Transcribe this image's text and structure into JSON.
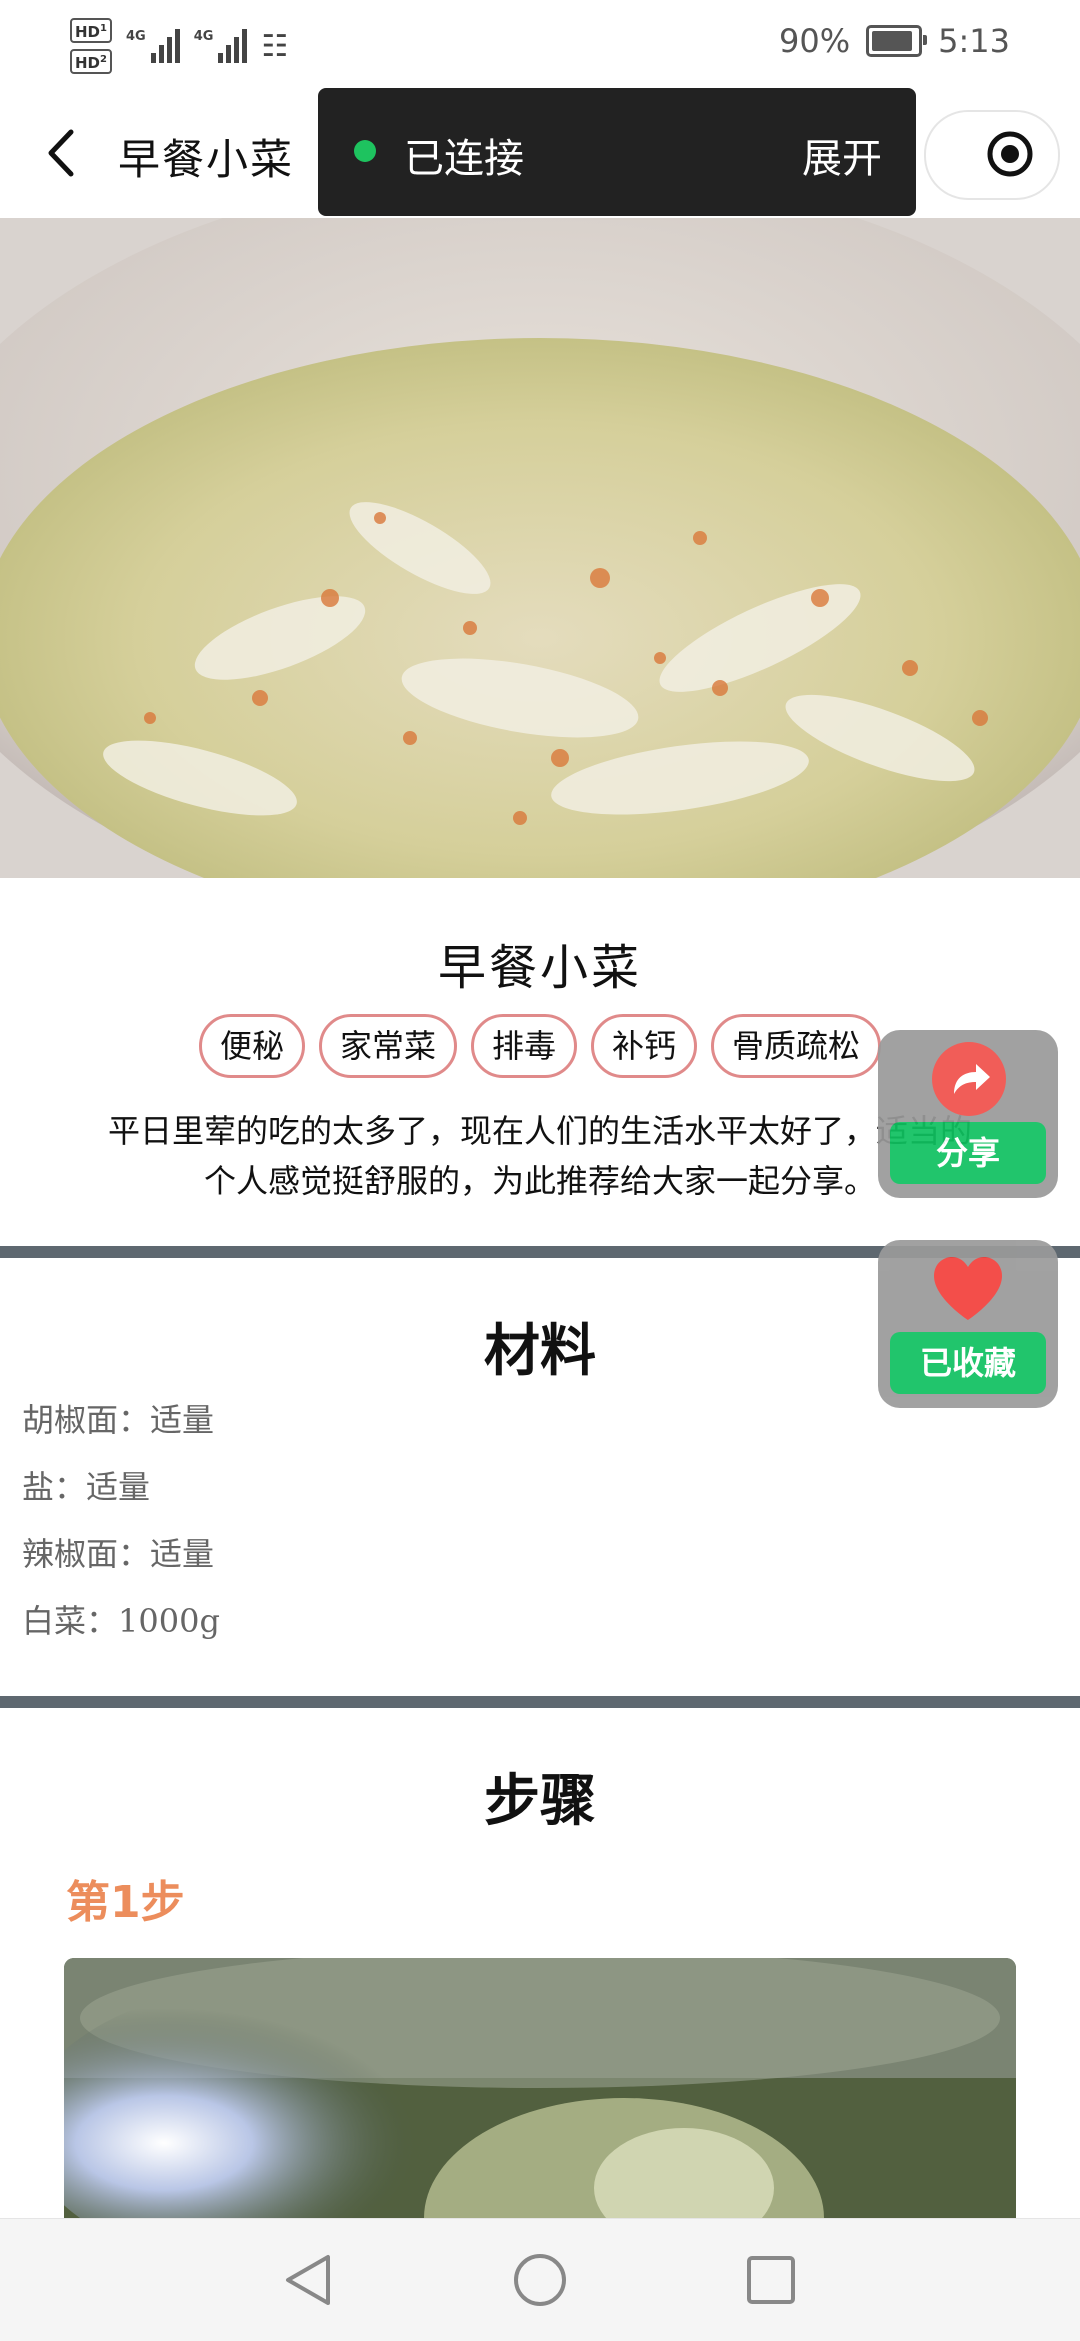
{
  "status_bar": {
    "sim1_badge": "HD",
    "sim1_index": "1",
    "sim2_badge": "HD",
    "sim2_index": "2",
    "network1": "4G",
    "network2": "4G",
    "battery_percent": "90%",
    "battery_level": 0.9,
    "time": "5:13"
  },
  "nav": {
    "title": "早餐小菜",
    "back_icon": "chevron-left-icon",
    "connection_status": "已连接",
    "expand_label": "展开",
    "capsule_icon": "target-icon",
    "status_dot_color": "#1ec35f"
  },
  "recipe": {
    "title": "早餐小菜",
    "tags": [
      "便秘",
      "家常菜",
      "排毒",
      "补钙",
      "骨质疏松"
    ],
    "description_line1": "平日里荤的吃的太多了，现在人们的生活水平太好了，适当的",
    "description_line2": "个人感觉挺舒服的，为此推荐给大家一起分享。"
  },
  "materials": {
    "heading": "材料",
    "items": [
      "胡椒面：适量",
      "盐：适量",
      "辣椒面：适量",
      "白菜：1000g"
    ]
  },
  "steps": {
    "heading": "步骤",
    "items": [
      {
        "label": "第1步"
      }
    ]
  },
  "floating_actions": {
    "share_label": "分享",
    "favorite_label": "已收藏",
    "share_icon": "share-arrow-icon",
    "favorite_icon": "heart-icon"
  },
  "colors": {
    "accent_green": "#0fc160",
    "tag_border": "#e08a8a",
    "step_label": "#ec8d5c",
    "divider": "#5e6870",
    "share_red": "#f0504a",
    "heart_red": "#f2403b"
  },
  "system_nav": {
    "back_icon": "triangle-back-icon",
    "home_icon": "circle-home-icon",
    "recents_icon": "square-recents-icon"
  }
}
